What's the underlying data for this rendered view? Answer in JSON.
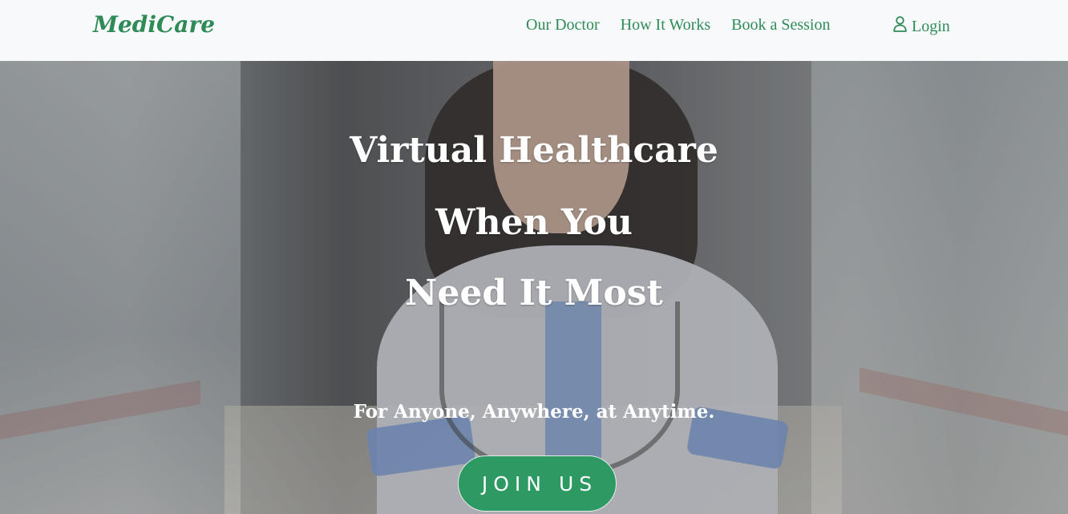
{
  "brand": {
    "name": "MediCare"
  },
  "nav": {
    "links": [
      "Our Doctor",
      "How It Works",
      "Book a Session"
    ],
    "login": "Login",
    "login_icon": "user-icon"
  },
  "hero": {
    "headline": [
      "Virtual Healthcare",
      "When You",
      "Need It Most"
    ],
    "tagline": "For Anyone, Anywhere, at Anytime.",
    "cta": "JOIN US"
  },
  "colors": {
    "accent": "#2e8b57",
    "button": "#2e9a63",
    "navbar": "#f8f9fa",
    "text_on_hero": "#ffffff"
  }
}
